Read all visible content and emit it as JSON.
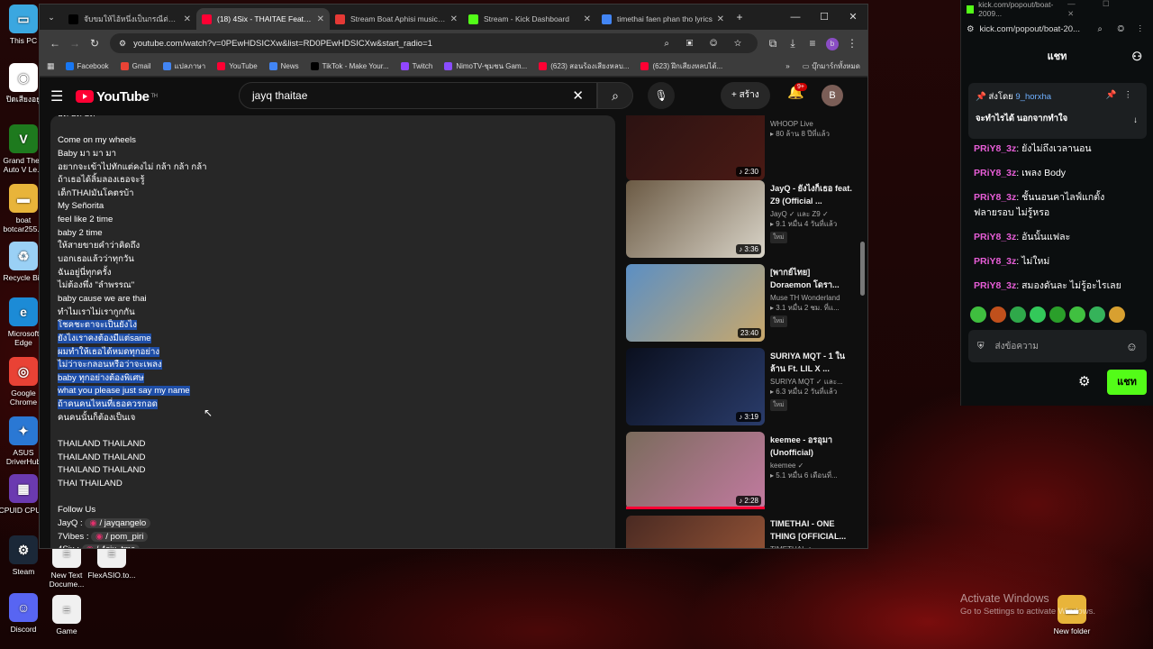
{
  "desktop": {
    "icons": [
      {
        "label": "This PC",
        "color": "#3ba7e0",
        "glyph": "▭"
      },
      {
        "label": "ปิดเสียงอยู่",
        "color": "#ffffff",
        "glyph": "◉"
      },
      {
        "label": "Grand Theft Auto V Le...",
        "color": "#1e7a1e",
        "glyph": "V"
      },
      {
        "label": "boat botcar255...",
        "color": "#e8b43a",
        "glyph": "▬"
      },
      {
        "label": "Recycle Bin",
        "color": "#9ad0f5",
        "glyph": "♻"
      },
      {
        "label": "Microsoft Edge",
        "color": "#1c8bd6",
        "glyph": "e"
      },
      {
        "label": "Google Chrome",
        "color": "#e94235",
        "glyph": "◎"
      },
      {
        "label": "ASUS DriverHub",
        "color": "#2a78d4",
        "glyph": "✦"
      },
      {
        "label": "CPUID CPU-Z",
        "color": "#6b3ab0",
        "glyph": "▦"
      },
      {
        "label": "Steam",
        "color": "#1b2838",
        "glyph": "⚙"
      },
      {
        "label": "Discord",
        "color": "#5865f2",
        "glyph": "☺"
      },
      {
        "label": "New Text Docume...",
        "color": "#f0f0f0",
        "glyph": "≡"
      },
      {
        "label": "FlexASIO.to...",
        "color": "#f0f0f0",
        "glyph": "≡"
      },
      {
        "label": "Game",
        "color": "#f0f0f0",
        "glyph": "≡"
      },
      {
        "label": "New folder",
        "color": "#e8b43a",
        "glyph": "▬"
      }
    ]
  },
  "browser": {
    "tabs": [
      {
        "label": "จับขมให้ไอ้หนึ่งเป็นกรณีต่อสำหรับคุณ",
        "icon": "tiktok-icon",
        "color": "#000000",
        "active": false
      },
      {
        "label": "(18) 4Six - THAITAE Feat. 7Vib...",
        "icon": "youtube-icon",
        "color": "#ff0033",
        "active": true
      },
      {
        "label": "Stream Boat Aphisi music | Li...",
        "icon": "stream-icon",
        "color": "#e53935",
        "active": false
      },
      {
        "label": "Stream - Kick Dashboard",
        "icon": "kick-icon",
        "color": "#53fc18",
        "active": false
      },
      {
        "label": "timethai faen phan tho lyrics",
        "icon": "google-icon",
        "color": "#4285f4",
        "active": false
      }
    ],
    "new_tab": "+",
    "url": "youtube.com/watch?v=0PEwHDSICXw&list=RD0PEwHDSICXw&start_radio=1",
    "bookmarks": [
      {
        "label": "Facebook",
        "color": "#1877f2"
      },
      {
        "label": "Gmail",
        "color": "#ea4335"
      },
      {
        "label": "แปลภาษา",
        "color": "#4285f4"
      },
      {
        "label": "YouTube",
        "color": "#ff0033"
      },
      {
        "label": "News",
        "color": "#4285f4"
      },
      {
        "label": "TikTok - Make Your...",
        "color": "#000000"
      },
      {
        "label": "Twitch",
        "color": "#9146ff"
      },
      {
        "label": "NimoTV-ชุมชน Gam...",
        "color": "#8a4dff"
      },
      {
        "label": "(623) สอนร้องเสียงหลบ...",
        "color": "#ff0033"
      },
      {
        "label": "(623) ฝึกเสียงหลบได้...",
        "color": "#ff0033"
      }
    ],
    "bookmarks_more": "»",
    "bookmarks_folder": "บุ๊กมาร์กทั้งหมด"
  },
  "youtube": {
    "logo": "YouTube",
    "logo_country": "TH",
    "search_value": "jayq thaitae",
    "create_label": "+ สร้าง",
    "notif_count": "9+",
    "avatar_letter": "B",
    "description_lines": [
      {
        "text": "ฮัด ฮัด ฮัด",
        "hl": false
      },
      {
        "text": "",
        "hl": false
      },
      {
        "text": "Come on my wheels",
        "hl": false
      },
      {
        "text": "Baby มา มา มา",
        "hl": false
      },
      {
        "text": "อยากจะเข้าไปทักแต่คงไม่ กล้า กล้า กล้า",
        "hl": false
      },
      {
        "text": "ถ้าเธอได้ลิ้มลองเธอจะรู้",
        "hl": false
      },
      {
        "text": "เด็กTHAIมันโคตรบ้า",
        "hl": false
      },
      {
        "text": "My Señorita",
        "hl": false
      },
      {
        "text": "feel like 2 time",
        "hl": false
      },
      {
        "text": "baby 2 time",
        "hl": false
      },
      {
        "text": "ให้สายขายคำว่าคิดถึง",
        "hl": false
      },
      {
        "text": "บอกเธอแล้วว่าทุกวัน",
        "hl": false
      },
      {
        "text": "ฉันอยู่นี่ทุกครั้ง",
        "hl": false
      },
      {
        "text": "ไม่ต้องพึ่ง \"ลำพรรณ\"",
        "hl": false
      },
      {
        "text": "baby cause we are thai",
        "hl": false
      },
      {
        "text": "ทำไมเราไม่เรากูกกัน",
        "hl": false
      },
      {
        "text": "โชคชะตาจะเป็นยังไง",
        "hl": true
      },
      {
        "text": "ยังไงเราคงต้องมีแต่same",
        "hl": true
      },
      {
        "text": "ผมทำให้เธอได้หมดทุกอย่าง",
        "hl": true
      },
      {
        "text": "ไม่ว่าจะกลอนหรือว่าจะเพลง",
        "hl": true
      },
      {
        "text": "baby ทุกอย่างต้องพิเศษ",
        "hl": true
      },
      {
        "text": "what you please just say my name",
        "hl": true
      },
      {
        "text": "ถ้าคนคนไหนที่เธอควรกอด",
        "hl": true
      },
      {
        "text": "คนคนนั้นก็ต้องเป็นเจ",
        "hl": false
      },
      {
        "text": "",
        "hl": false
      },
      {
        "text": "THAILAND THAILAND",
        "hl": false
      },
      {
        "text": "THAILAND THAILAND",
        "hl": false
      },
      {
        "text": "THAILAND THAILAND",
        "hl": false
      },
      {
        "text": "THAI THAILAND",
        "hl": false
      },
      {
        "text": "",
        "hl": false
      },
      {
        "text": "Follow Us",
        "hl": false
      }
    ],
    "follow": [
      {
        "name": "JayQ :",
        "handle": "/ jayqangelo"
      },
      {
        "name": "7Vibes :",
        "handle": "/ pom_piri"
      },
      {
        "name": "4Six :",
        "handle": "/ 4six_tmc"
      }
    ],
    "related": [
      {
        "title": "produced by ...",
        "channel": "WHOOP Live",
        "stats": "▸ 80 ล้าน  8 ปีที่แล้ว",
        "duration": "♪ 2:30",
        "new": false,
        "c1": "#2a1212",
        "c2": "#4a1a14"
      },
      {
        "title": "JayQ - ยังไงก็เธอ feat. Z9 (Official ...",
        "channel": "JayQ ✓ และ Z9 ✓",
        "stats": "▸ 9.1 หมื่น  4 วันที่แล้ว",
        "duration": "♪ 3:36",
        "new": true,
        "c1": "#6b5a44",
        "c2": "#d9d4c8"
      },
      {
        "title": "[พากย์ไทย] Doraemon โดรา...",
        "channel": "Muse TH Wonderland",
        "stats": "▸ 3.1 หมื่น  2 ชม. ที่แ...",
        "duration": "23:40",
        "new": true,
        "c1": "#5b8fc4",
        "c2": "#c9a86b"
      },
      {
        "title": "SURIYA MQT - 1 ใน ล้าน Ft. LIL X ...",
        "channel": "SURIYA MQT ✓ และ...",
        "stats": "▸ 6.3 หมื่น  2 วันที่แล้ว",
        "duration": "♪ 3:19",
        "new": true,
        "c1": "#0a0f1e",
        "c2": "#2a3c6b"
      },
      {
        "title": "keemee - อรอุมา (Unofficial)",
        "channel": "keemee ✓",
        "stats": "▸ 5.1 หมื่น  6 เดือนที่...",
        "duration": "♪ 2:28",
        "new": false,
        "c1": "#7a6b5c",
        "c2": "#c27aa0"
      },
      {
        "title": "TIMETHAI - ONE THING [OFFICIAL...",
        "channel": "TIMETHAI ✓",
        "stats": "",
        "duration": "",
        "new": false,
        "c1": "#4a2a22",
        "c2": "#a05a3a"
      }
    ],
    "new_badge": "ใหม่"
  },
  "kick": {
    "window_title": "kick.com/popout/boat-2009...",
    "url": "kick.com/popout/boat-20...",
    "header": "แชท",
    "pinned_by": "ส่งโดย",
    "pinned_user": "9_horxha",
    "pinned_text": "จะทำไรได้ นอกจากทำใจ",
    "messages": [
      {
        "user": "PRiY8_3z",
        "text": ": ยังไม่ถึงเวลานอน"
      },
      {
        "user": "PRiY8_3z",
        "text": ": เพลง Body"
      },
      {
        "user": "PRiY8_3z",
        "text": ": ชั้นนอนคาไลฟ์แกตั้ง"
      },
      {
        "user": "",
        "text": "ฟลายรอบ ไม่รู้หรอ"
      },
      {
        "user": "PRiY8_3z",
        "text": ": อันนั้นแฟละ"
      },
      {
        "user": "PRiY8_3z",
        "text": ": ไม่ใหม่"
      },
      {
        "user": "PRiY8_3z",
        "text": ": สมองดันละ ไม่รู้อะไรเลย"
      }
    ],
    "emote_colors": [
      "#3fbf3f",
      "#c0501c",
      "#2fa84a",
      "#33c95a",
      "#2a9f2a",
      "#40c040",
      "#35b35a",
      "#d8a030"
    ],
    "input_placeholder": "ส่งข้อความ",
    "send_label": "แชท"
  },
  "watermark": {
    "title": "Activate Windows",
    "sub": "Go to Settings to activate Windows."
  }
}
